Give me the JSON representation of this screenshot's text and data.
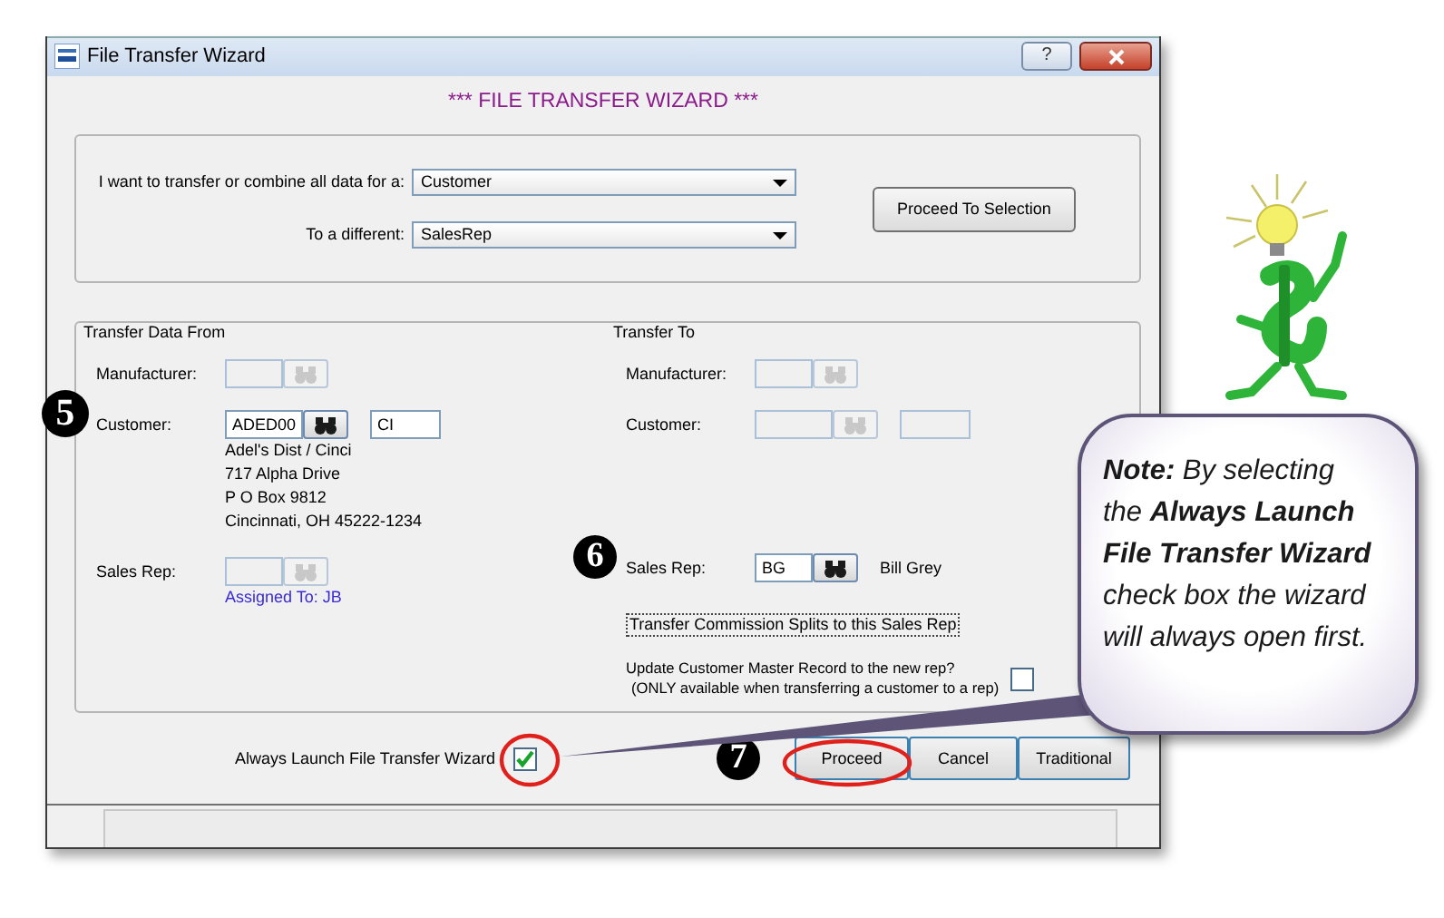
{
  "window": {
    "title": "File Transfer Wizard",
    "help_button": "?"
  },
  "heading": "*** FILE TRANSFER WIZARD ***",
  "selection": {
    "fields": [
      {
        "label": "I want to transfer or combine all data for a:",
        "value": "Customer"
      },
      {
        "label": "To a different:",
        "value": "SalesRep"
      }
    ],
    "button": "Proceed To Selection"
  },
  "transfer_from": {
    "title": "Transfer Data From",
    "rows": [
      {
        "label": "Manufacturer:",
        "disabled": true
      },
      {
        "label": "Customer:",
        "disabled": false,
        "value": "ADED00",
        "extra_field": true,
        "extra_value": "CI",
        "details": [
          "Adel's Dist / Cinci",
          "717 Alpha Drive",
          "P O Box 9812",
          "Cincinnati, OH 45222-1234"
        ]
      },
      {
        "label": "Sales Rep:",
        "disabled": true,
        "note": "Assigned To: JB"
      }
    ]
  },
  "transfer_to": {
    "title": "Transfer To",
    "rows": [
      {
        "label": "Manufacturer:",
        "disabled": true
      },
      {
        "label": "Customer:",
        "disabled": true,
        "extra_field": true
      },
      {
        "label": "Sales Rep:",
        "disabled": false,
        "value": "BG",
        "name": "Bill Grey"
      }
    ],
    "options": [
      {
        "kind": "focus_label",
        "label": "Transfer Commission Splits to this Sales Rep"
      },
      {
        "kind": "checkbox",
        "lines": [
          "Update Customer Master Record to the new rep?",
          "(ONLY available when transferring a customer to a rep)"
        ],
        "checked": false
      }
    ]
  },
  "always_launch": {
    "label": "Always Launch File Transfer Wizard",
    "checked": true,
    "highlighted": true
  },
  "buttons": [
    {
      "label": "Proceed",
      "highlighted": true
    },
    {
      "label": "Cancel",
      "highlighted": false
    },
    {
      "label": "Traditional",
      "highlighted": false
    }
  ],
  "annotations": {
    "markers": [
      "5",
      "6",
      "7"
    ],
    "note": "**Note:**  By selecting the **Always Launch File Transfer Wizard** check box the wizard will always open first."
  }
}
